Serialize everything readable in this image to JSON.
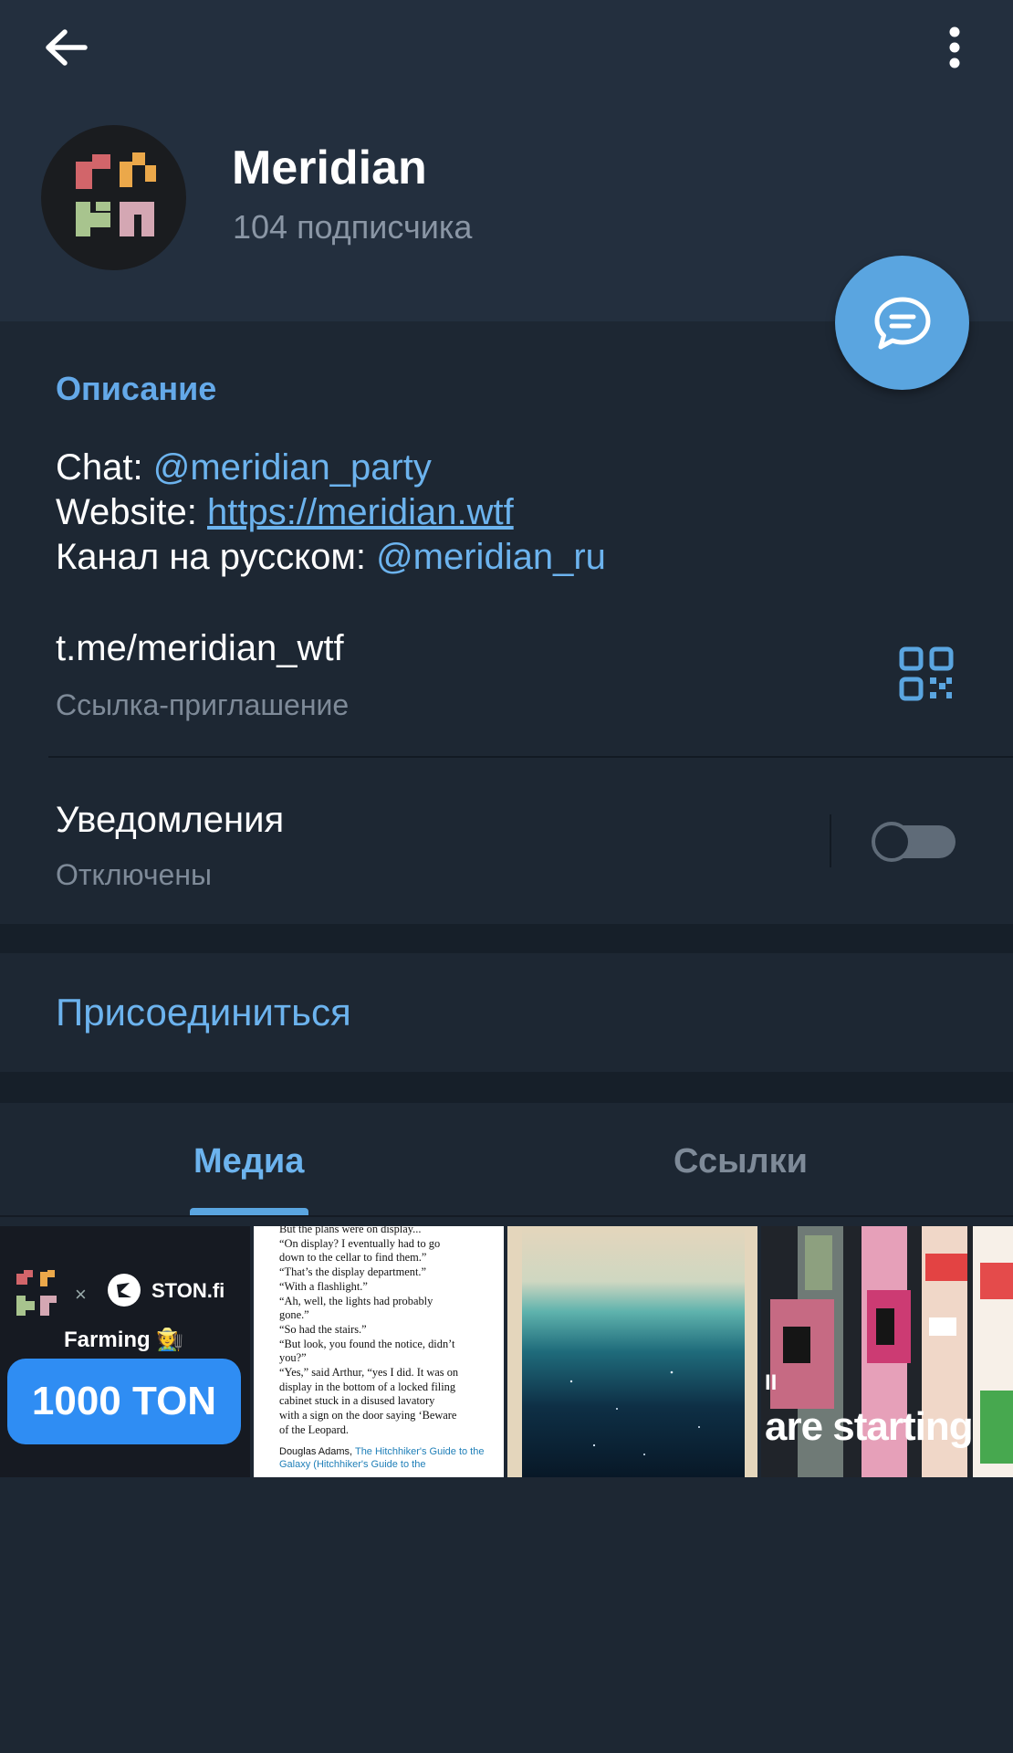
{
  "header": {
    "channel_name": "Meridian",
    "subscribers": "104 подписчика"
  },
  "description": {
    "label": "Описание",
    "chat_prefix": "Chat: ",
    "chat_link": "@meridian_party",
    "website_prefix": "Website: ",
    "website_link": "https://meridian.wtf",
    "ru_prefix": "Канал на русском: ",
    "ru_link": "@meridian_ru"
  },
  "invite": {
    "link": "t.me/meridian_wtf",
    "subtitle": "Ссылка-приглашение"
  },
  "notifications": {
    "title": "Уведомления",
    "status": "Отключены",
    "enabled": false
  },
  "actions": {
    "join_label": "Присоединиться"
  },
  "tabs": [
    {
      "label": "Медиа",
      "active": true
    },
    {
      "label": "Ссылки",
      "active": false
    }
  ],
  "media": {
    "thumb1": {
      "partner": "STON.fi",
      "farming": "Farming 🧑‍🌾",
      "amount": "1000 TON"
    },
    "thumb2": {
      "lines": [
        "But the plans were on display...",
        "“On display? I eventually had to go",
        "down to the cellar to find them.”",
        "“That’s the display department.”",
        "“With a flashlight.”",
        "“Ah, well, the lights had probably",
        "gone.”",
        "“So had the stairs.”",
        "“But look, you found the notice, didn’t",
        "you?”",
        "“Yes,” said Arthur, “yes I did. It was on",
        "display in the bottom of a locked filing",
        "cabinet stuck in a disused lavatory",
        "with a sign on the door saying ‘Beware",
        "of the Leopard."
      ],
      "author": "Douglas Adams,",
      "book": "The Hitchhiker's Guide to the Galaxy (Hitchhiker's Guide to the"
    },
    "thumb4": {
      "caption": "are starting"
    }
  },
  "colors": {
    "accent": "#6cb3ee",
    "background": "#1d2733",
    "header_bg": "#232f3e",
    "fab": "#5aa5e0"
  }
}
